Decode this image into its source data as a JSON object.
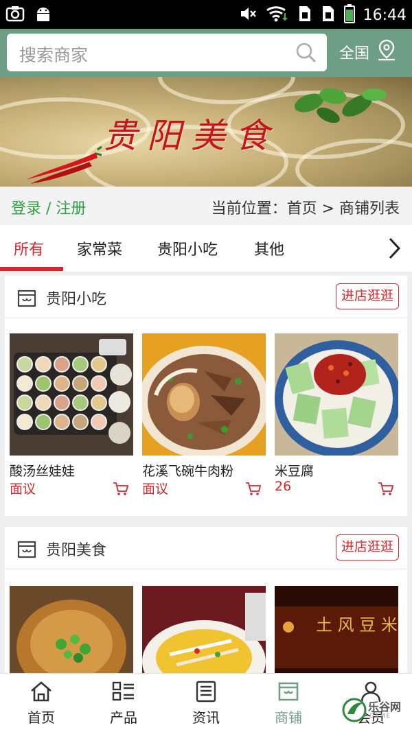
{
  "status_bar": {
    "time": "16:44",
    "left_icons": [
      "screenshot-icon",
      "android-icon"
    ],
    "right_icons": [
      "mute-icon",
      "wifi-icon",
      "sim1-icon",
      "sim2-icon",
      "battery-icon"
    ]
  },
  "header": {
    "search_placeholder": "搜索商家",
    "region_label": "全国"
  },
  "banner": {
    "title": "贵阳美食"
  },
  "crumbbar": {
    "login_label": "登录 / 注册",
    "breadcrumb": "当前位置：首页 > 商铺列表"
  },
  "tabs": [
    {
      "label": "所有",
      "active": true
    },
    {
      "label": "家常菜",
      "active": false
    },
    {
      "label": "贵阳小吃",
      "active": false
    },
    {
      "label": "其他",
      "active": false
    }
  ],
  "stores": [
    {
      "name": "贵阳小吃",
      "enter_label": "进店逛逛",
      "products": [
        {
          "name": "酸汤丝娃娃",
          "price": "面议",
          "image": "dish-suantang-siwawa"
        },
        {
          "name": "花溪飞碗牛肉粉",
          "price": "面议",
          "image": "dish-huaxi-beef-noodle"
        },
        {
          "name": "米豆腐",
          "price": "26",
          "image": "dish-mi-doufu"
        }
      ]
    },
    {
      "name": "贵阳美食",
      "enter_label": "进店逛逛",
      "products": [
        {
          "image": "dish-fried-tofu"
        },
        {
          "image": "dish-fish-soup"
        },
        {
          "image": "restaurant-sign"
        }
      ]
    }
  ],
  "bottom_nav": [
    {
      "label": "首页",
      "icon": "home-icon",
      "active": false
    },
    {
      "label": "产品",
      "icon": "grid-icon",
      "active": false
    },
    {
      "label": "资讯",
      "icon": "news-icon",
      "active": false
    },
    {
      "label": "商铺",
      "icon": "store-icon",
      "active": true
    },
    {
      "label": "会员",
      "icon": "user-icon",
      "active": false
    }
  ],
  "watermark": {
    "text": "乐谷网",
    "sub": "GAME"
  },
  "colors": {
    "header_green": "#6f9e86",
    "accent_red": "#d7272a",
    "login_green": "#2ea043"
  }
}
